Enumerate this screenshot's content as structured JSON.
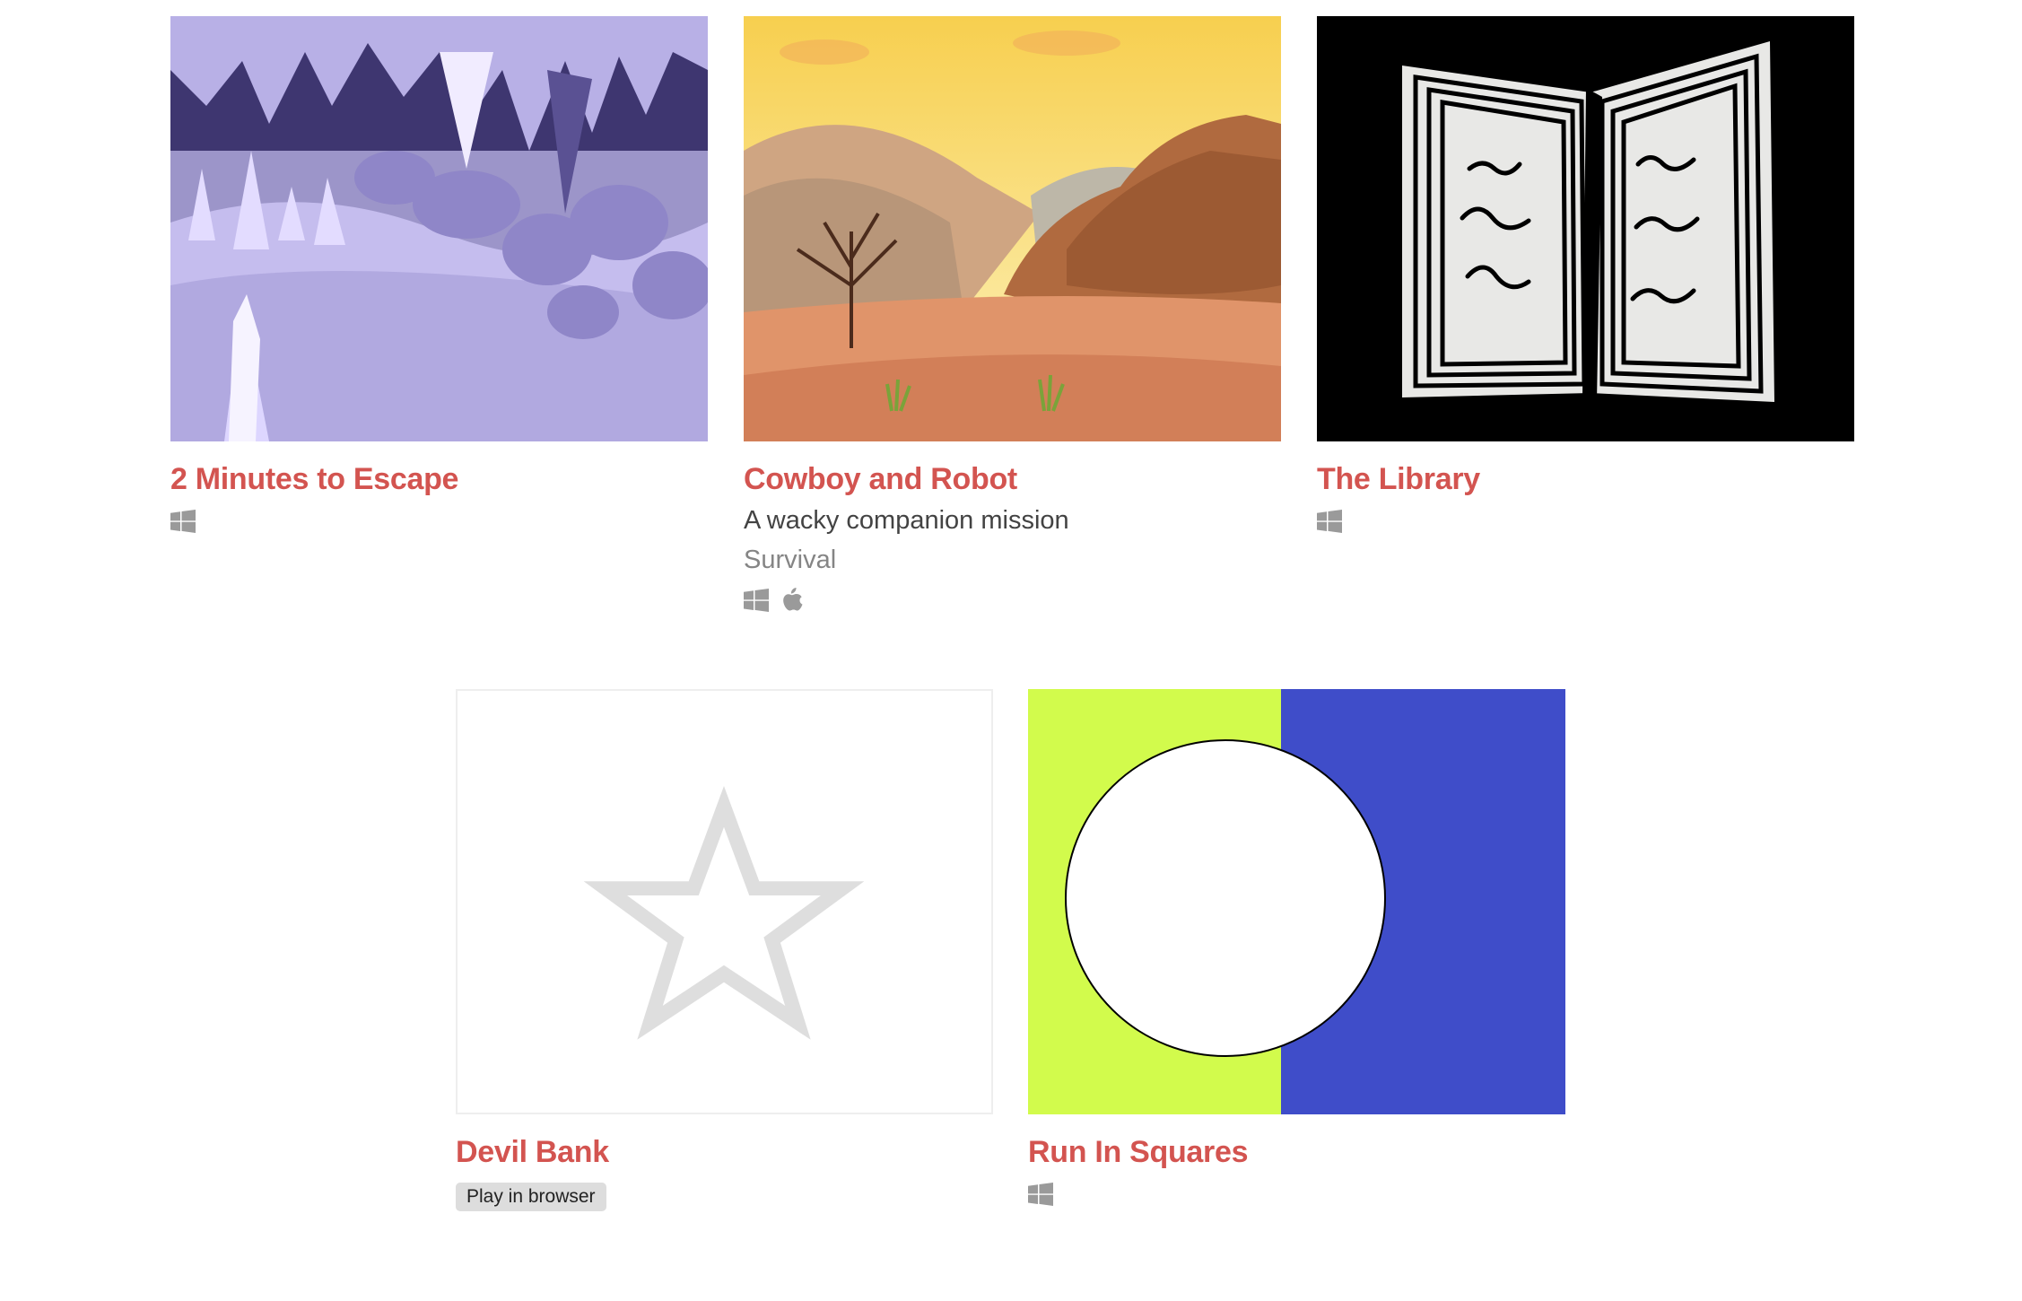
{
  "games": [
    {
      "title": "2 Minutes to Escape",
      "platforms": [
        "windows-icon"
      ]
    },
    {
      "title": "Cowboy and Robot",
      "short_text": "A wacky companion mission",
      "genre": "Survival",
      "platforms": [
        "windows-icon",
        "apple-icon"
      ]
    },
    {
      "title": "The Library",
      "platforms": [
        "windows-icon"
      ]
    },
    {
      "title": "Devil Bank",
      "thumbnail_placeholder": "star-icon",
      "web_flag": "Play in browser"
    },
    {
      "title": "Run In Squares",
      "platforms": [
        "windows-icon"
      ]
    }
  ],
  "colors": {
    "title": "#d35450",
    "text": "#434343",
    "genre": "#858585",
    "platform_icon": "#9a9a9a",
    "badge_bg": "#dddddd"
  }
}
